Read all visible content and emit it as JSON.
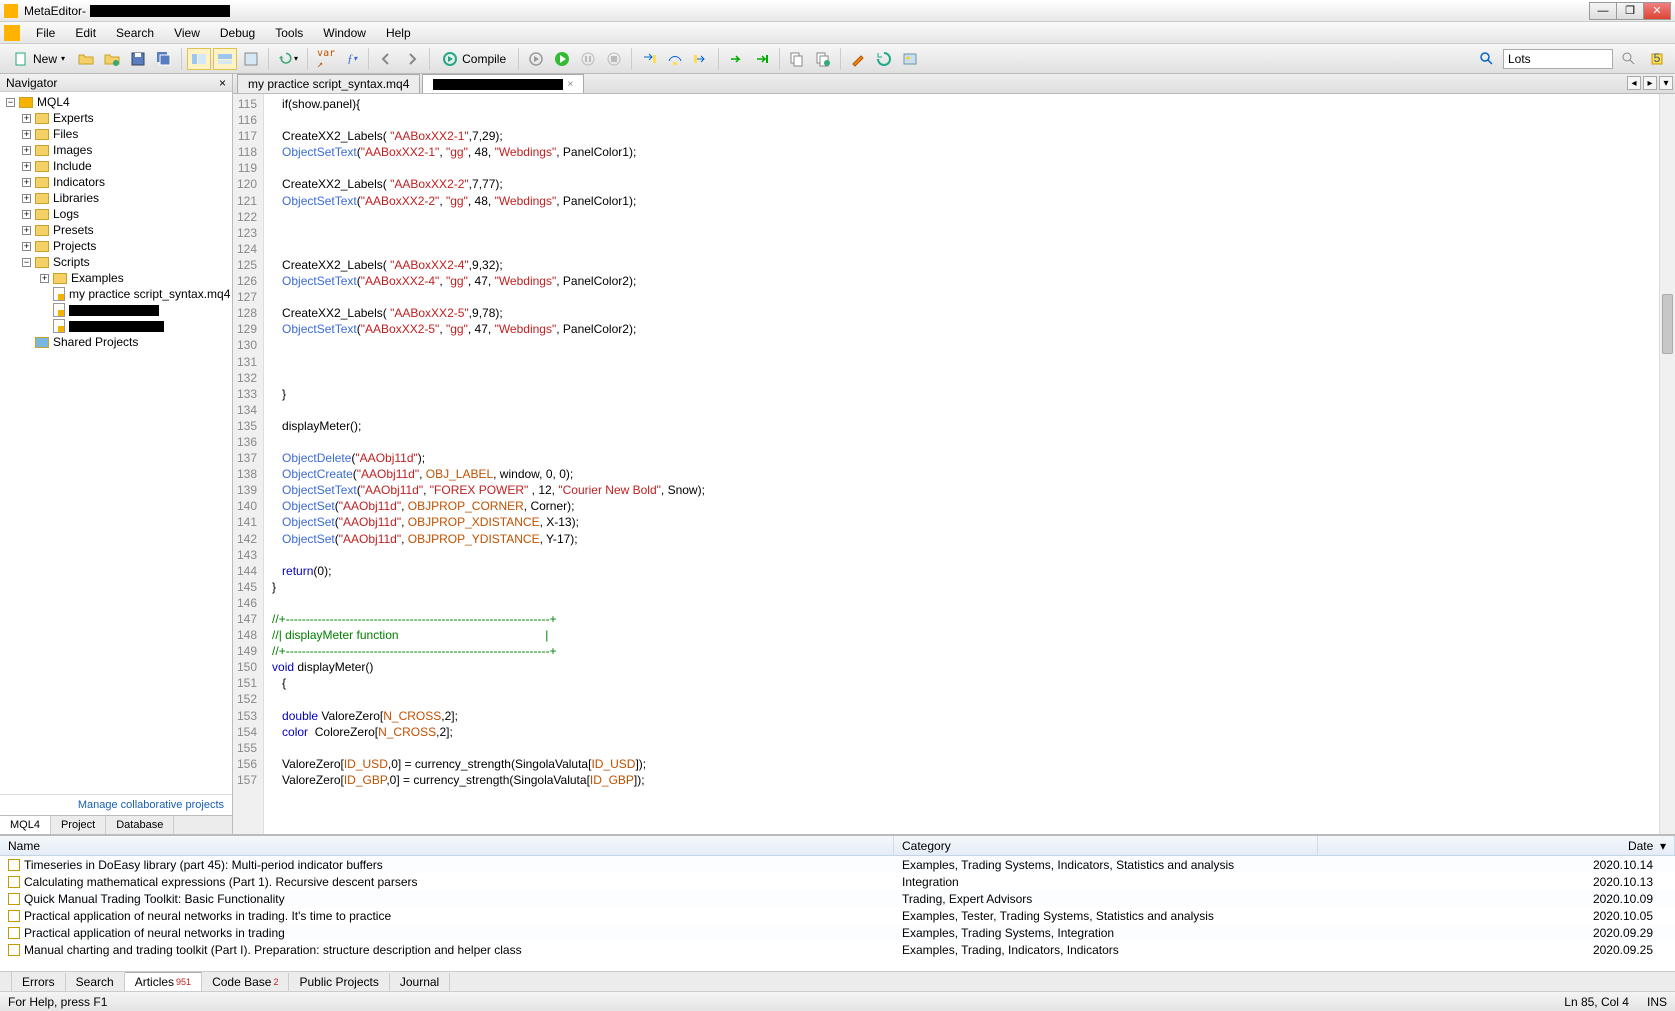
{
  "app": {
    "name": "MetaEditor"
  },
  "menus": [
    "File",
    "Edit",
    "Search",
    "View",
    "Debug",
    "Tools",
    "Window",
    "Help"
  ],
  "toolbar": {
    "new": "New",
    "compile": "Compile",
    "search_placeholder": "Lots"
  },
  "navigator": {
    "title": "Navigator",
    "root": "MQL4",
    "folders": [
      "Experts",
      "Files",
      "Images",
      "Include",
      "Indicators",
      "Libraries",
      "Logs",
      "Presets",
      "Projects",
      "Scripts"
    ],
    "scripts_sub": "Examples",
    "script_file": "my practice script_syntax.mq4",
    "shared": "Shared Projects",
    "footer": "Manage collaborative projects",
    "tabs": [
      "MQL4",
      "Project",
      "Database"
    ]
  },
  "editor": {
    "tabs": [
      {
        "label": "my practice script_syntax.mq4",
        "active": false
      },
      {
        "label": "",
        "active": true,
        "redacted": true
      }
    ],
    "first_line": 115,
    "lines": [
      [
        {
          "t": "if",
          "c": ""
        },
        {
          "t": "(show.panel){",
          "c": ""
        }
      ],
      [],
      [
        {
          "t": "CreateXX2_Labels( ",
          "c": ""
        },
        {
          "t": "\"AABoxXX2-1\"",
          "c": "k-str"
        },
        {
          "t": ",",
          "c": ""
        },
        {
          "t": "7",
          "c": "k-num"
        },
        {
          "t": ",",
          "c": ""
        },
        {
          "t": "29",
          "c": "k-num"
        },
        {
          "t": ");",
          "c": ""
        }
      ],
      [
        {
          "t": "ObjectSetText",
          "c": "k-fn"
        },
        {
          "t": "(",
          "c": ""
        },
        {
          "t": "\"AABoxXX2-1\"",
          "c": "k-str"
        },
        {
          "t": ", ",
          "c": ""
        },
        {
          "t": "\"gg\"",
          "c": "k-str"
        },
        {
          "t": ", ",
          "c": ""
        },
        {
          "t": "48",
          "c": "k-num"
        },
        {
          "t": ", ",
          "c": ""
        },
        {
          "t": "\"Webdings\"",
          "c": "k-str"
        },
        {
          "t": ", PanelColor1);",
          "c": ""
        }
      ],
      [],
      [
        {
          "t": "CreateXX2_Labels( ",
          "c": ""
        },
        {
          "t": "\"AABoxXX2-2\"",
          "c": "k-str"
        },
        {
          "t": ",",
          "c": ""
        },
        {
          "t": "7",
          "c": "k-num"
        },
        {
          "t": ",",
          "c": ""
        },
        {
          "t": "77",
          "c": "k-num"
        },
        {
          "t": ");",
          "c": ""
        }
      ],
      [
        {
          "t": "ObjectSetText",
          "c": "k-fn"
        },
        {
          "t": "(",
          "c": ""
        },
        {
          "t": "\"AABoxXX2-2\"",
          "c": "k-str"
        },
        {
          "t": ", ",
          "c": ""
        },
        {
          "t": "\"gg\"",
          "c": "k-str"
        },
        {
          "t": ", ",
          "c": ""
        },
        {
          "t": "48",
          "c": "k-num"
        },
        {
          "t": ", ",
          "c": ""
        },
        {
          "t": "\"Webdings\"",
          "c": "k-str"
        },
        {
          "t": ", PanelColor1);",
          "c": ""
        }
      ],
      [],
      [],
      [],
      [
        {
          "t": "CreateXX2_Labels( ",
          "c": ""
        },
        {
          "t": "\"AABoxXX2-4\"",
          "c": "k-str"
        },
        {
          "t": ",",
          "c": ""
        },
        {
          "t": "9",
          "c": "k-num"
        },
        {
          "t": ",",
          "c": ""
        },
        {
          "t": "32",
          "c": "k-num"
        },
        {
          "t": ");",
          "c": ""
        }
      ],
      [
        {
          "t": "ObjectSetText",
          "c": "k-fn"
        },
        {
          "t": "(",
          "c": ""
        },
        {
          "t": "\"AABoxXX2-4\"",
          "c": "k-str"
        },
        {
          "t": ", ",
          "c": ""
        },
        {
          "t": "\"gg\"",
          "c": "k-str"
        },
        {
          "t": ", ",
          "c": ""
        },
        {
          "t": "47",
          "c": "k-num"
        },
        {
          "t": ", ",
          "c": ""
        },
        {
          "t": "\"Webdings\"",
          "c": "k-str"
        },
        {
          "t": ", PanelColor2);",
          "c": ""
        }
      ],
      [],
      [
        {
          "t": "CreateXX2_Labels( ",
          "c": ""
        },
        {
          "t": "\"AABoxXX2-5\"",
          "c": "k-str"
        },
        {
          "t": ",",
          "c": ""
        },
        {
          "t": "9",
          "c": "k-num"
        },
        {
          "t": ",",
          "c": ""
        },
        {
          "t": "78",
          "c": "k-num"
        },
        {
          "t": ");",
          "c": ""
        }
      ],
      [
        {
          "t": "ObjectSetText",
          "c": "k-fn"
        },
        {
          "t": "(",
          "c": ""
        },
        {
          "t": "\"AABoxXX2-5\"",
          "c": "k-str"
        },
        {
          "t": ", ",
          "c": ""
        },
        {
          "t": "\"gg\"",
          "c": "k-str"
        },
        {
          "t": ", ",
          "c": ""
        },
        {
          "t": "47",
          "c": "k-num"
        },
        {
          "t": ", ",
          "c": ""
        },
        {
          "t": "\"Webdings\"",
          "c": "k-str"
        },
        {
          "t": ", PanelColor2);",
          "c": ""
        }
      ],
      [],
      [],
      [],
      [
        {
          "t": "}",
          "c": ""
        }
      ],
      [],
      [
        {
          "t": "displayMeter();",
          "c": ""
        }
      ],
      [],
      [
        {
          "t": "ObjectDelete",
          "c": "k-fn"
        },
        {
          "t": "(",
          "c": ""
        },
        {
          "t": "\"AAObj11d\"",
          "c": "k-str"
        },
        {
          "t": ");",
          "c": ""
        }
      ],
      [
        {
          "t": "ObjectCreate",
          "c": "k-fn"
        },
        {
          "t": "(",
          "c": ""
        },
        {
          "t": "\"AAObj11d\"",
          "c": "k-str"
        },
        {
          "t": ", ",
          "c": ""
        },
        {
          "t": "OBJ_LABEL",
          "c": "k-const"
        },
        {
          "t": ", window, ",
          "c": ""
        },
        {
          "t": "0",
          "c": "k-num"
        },
        {
          "t": ", ",
          "c": ""
        },
        {
          "t": "0",
          "c": "k-num"
        },
        {
          "t": ");",
          "c": ""
        }
      ],
      [
        {
          "t": "ObjectSetText",
          "c": "k-fn"
        },
        {
          "t": "(",
          "c": ""
        },
        {
          "t": "\"AAObj11d\"",
          "c": "k-str"
        },
        {
          "t": ", ",
          "c": ""
        },
        {
          "t": "\"FOREX POWER\"",
          "c": "k-str"
        },
        {
          "t": " , ",
          "c": ""
        },
        {
          "t": "12",
          "c": "k-num"
        },
        {
          "t": ", ",
          "c": ""
        },
        {
          "t": "\"Courier New Bold\"",
          "c": "k-str"
        },
        {
          "t": ", Snow);",
          "c": ""
        }
      ],
      [
        {
          "t": "ObjectSet",
          "c": "k-fn"
        },
        {
          "t": "(",
          "c": ""
        },
        {
          "t": "\"AAObj11d\"",
          "c": "k-str"
        },
        {
          "t": ", ",
          "c": ""
        },
        {
          "t": "OBJPROP_CORNER",
          "c": "k-const"
        },
        {
          "t": ", Corner);",
          "c": ""
        }
      ],
      [
        {
          "t": "ObjectSet",
          "c": "k-fn"
        },
        {
          "t": "(",
          "c": ""
        },
        {
          "t": "\"AAObj11d\"",
          "c": "k-str"
        },
        {
          "t": ", ",
          "c": ""
        },
        {
          "t": "OBJPROP_XDISTANCE",
          "c": "k-const"
        },
        {
          "t": ", X-",
          "c": ""
        },
        {
          "t": "13",
          "c": "k-num"
        },
        {
          "t": ");",
          "c": ""
        }
      ],
      [
        {
          "t": "ObjectSet",
          "c": "k-fn"
        },
        {
          "t": "(",
          "c": ""
        },
        {
          "t": "\"AAObj11d\"",
          "c": "k-str"
        },
        {
          "t": ", ",
          "c": ""
        },
        {
          "t": "OBJPROP_YDISTANCE",
          "c": "k-const"
        },
        {
          "t": ", Y-",
          "c": ""
        },
        {
          "t": "17",
          "c": "k-num"
        },
        {
          "t": ");",
          "c": ""
        }
      ],
      [],
      [
        {
          "t": "return",
          "c": "k-kw"
        },
        {
          "t": "(",
          "c": ""
        },
        {
          "t": "0",
          "c": "k-num"
        },
        {
          "t": ");",
          "c": ""
        }
      ],
      [
        {
          "t": "}",
          "c": "",
          "noindent": true
        }
      ],
      [],
      [
        {
          "t": "//+------------------------------------------------------------------+",
          "c": "k-cmt",
          "noindent": true
        }
      ],
      [
        {
          "t": "//| displayMeter function                                            |",
          "c": "k-cmt",
          "noindent": true
        }
      ],
      [
        {
          "t": "//+------------------------------------------------------------------+",
          "c": "k-cmt",
          "noindent": true
        }
      ],
      [
        {
          "t": "void",
          "c": "k-kw",
          "noindent": true
        },
        {
          "t": " displayMeter()",
          "c": ""
        }
      ],
      [
        {
          "t": "{",
          "c": ""
        }
      ],
      [],
      [
        {
          "t": "double",
          "c": "k-kw"
        },
        {
          "t": " ValoreZero[",
          "c": ""
        },
        {
          "t": "N_CROSS",
          "c": "k-const"
        },
        {
          "t": ",",
          "c": ""
        },
        {
          "t": "2",
          "c": "k-num"
        },
        {
          "t": "];",
          "c": ""
        }
      ],
      [
        {
          "t": "color",
          "c": "k-kw"
        },
        {
          "t": "  ColoreZero[",
          "c": ""
        },
        {
          "t": "N_CROSS",
          "c": "k-const"
        },
        {
          "t": ",",
          "c": ""
        },
        {
          "t": "2",
          "c": "k-num"
        },
        {
          "t": "];",
          "c": ""
        }
      ],
      [],
      [
        {
          "t": "ValoreZero[",
          "c": ""
        },
        {
          "t": "ID_USD",
          "c": "k-const"
        },
        {
          "t": ",",
          "c": ""
        },
        {
          "t": "0",
          "c": "k-num"
        },
        {
          "t": "] = currency_strength(SingolaValuta[",
          "c": ""
        },
        {
          "t": "ID_USD",
          "c": "k-const"
        },
        {
          "t": "]);",
          "c": ""
        }
      ],
      [
        {
          "t": "ValoreZero[",
          "c": ""
        },
        {
          "t": "ID_GBP",
          "c": "k-const"
        },
        {
          "t": ",",
          "c": ""
        },
        {
          "t": "0",
          "c": "k-num"
        },
        {
          "t": "] = currency_strength(SingolaValuta[",
          "c": ""
        },
        {
          "t": "ID_GBP",
          "c": "k-const"
        },
        {
          "t": "]);",
          "c": ""
        }
      ]
    ]
  },
  "lower": {
    "columns": {
      "name": "Name",
      "category": "Category",
      "date": "Date"
    },
    "rows": [
      {
        "name": "Timeseries in DoEasy library (part 45): Multi-period indicator buffers",
        "category": "Examples, Trading Systems, Indicators, Statistics and analysis",
        "date": "2020.10.14"
      },
      {
        "name": "Calculating mathematical expressions (Part 1). Recursive descent parsers",
        "category": "Integration",
        "date": "2020.10.13"
      },
      {
        "name": "Quick Manual Trading Toolkit: Basic Functionality",
        "category": "Trading, Expert Advisors",
        "date": "2020.10.09"
      },
      {
        "name": "Practical application of neural networks in trading. It's time to practice",
        "category": "Examples, Tester, Trading Systems, Statistics and analysis",
        "date": "2020.10.05"
      },
      {
        "name": "Practical application of neural networks in trading",
        "category": "Examples, Trading Systems, Integration",
        "date": "2020.09.29"
      },
      {
        "name": "Manual charting and trading toolkit (Part I). Preparation: structure description and helper class",
        "category": "Examples, Trading, Indicators, Indicators",
        "date": "2020.09.25"
      }
    ],
    "tabs": [
      {
        "label": "Errors"
      },
      {
        "label": "Search"
      },
      {
        "label": "Articles",
        "badge": "951",
        "active": true
      },
      {
        "label": "Code Base",
        "badge": "2"
      },
      {
        "label": "Public Projects"
      },
      {
        "label": "Journal"
      }
    ]
  },
  "status": {
    "left": "For Help, press F1",
    "pos": "Ln 85, Col 4",
    "mode": "INS"
  }
}
